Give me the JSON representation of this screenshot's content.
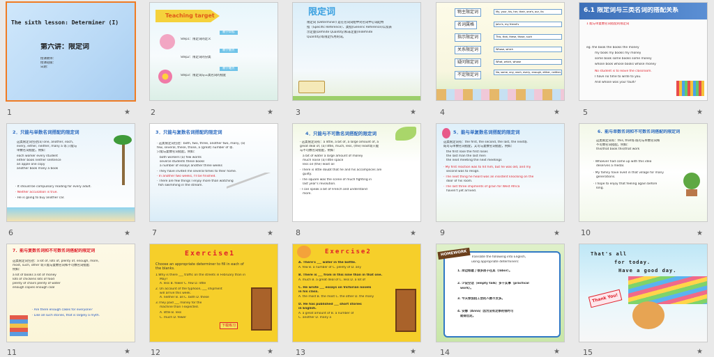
{
  "slides": [
    {
      "n": "1",
      "title": "The sixth lesson: Determiner (I)",
      "sub": "第六讲：限定词",
      "meta": [
        "授课教师：",
        "授课班级：",
        "日期："
      ]
    },
    {
      "n": "2",
      "title": "Teaching target",
      "steps": [
        "Step1：限定词的定义",
        "Step2：限定词的分类",
        "Step3：限定词与三类名词的搭配"
      ],
      "tags": [
        "教学目标",
        "教学重点",
        "教学难点"
      ]
    },
    {
      "n": "3",
      "title": "限定词",
      "lines": [
        "限定词 (Determiner) 是在名词词组中对名词中心词起特",
        "指（Specific Reference）、类指(Generic Reference)以及表",
        "示定量(Definite Quantity)和非定量(Indefinite",
        "Quantity)等限定作用的词。"
      ]
    },
    {
      "n": "4",
      "cats": [
        "物主限定词",
        "名词属格",
        "指示限定词",
        "关系限定词",
        "疑问限定词",
        "不定限定词"
      ],
      "vals": [
        "My, your, his, her, their, one's, our, its",
        "John's, my friend's",
        "This, that, these, those, such",
        "Whose, which",
        "What, which, whose",
        "No, some, any, each, every, enough, either, neither, all, both, half, several, many, much, more, most..."
      ]
    },
    {
      "n": "5",
      "title": "6.1 限定词与三类名词的搭配关系",
      "lines": [
        "1  能与单复数名词搭配的限定词",
        "eg. the book     the books     the money",
        "my book    my books    my money",
        "some book  some books  some money",
        "whose book  whose books  whose money",
        "No student is to leave the classroom.",
        "I have no time to write to you.",
        "And whose was your fault?"
      ]
    },
    {
      "n": "6",
      "title": "2．只能与单数名词搭配的限定词",
      "lines": [
        "这类限定词包括(a) one, another, each,",
        "every, either, neither, many a 等.只能与",
        "单数名词搭配，例如：",
        "each worker       every student",
        "either book       neither sentence",
        "an apple          one copy",
        "another book      many a book",
        "· It should be compulsory reading for every adult.",
        "· Neither accusation is true.",
        "· He is going to buy another car."
      ]
    },
    {
      "n": "7",
      "title": "3．只能与复数名词搭配的限定词",
      "lines": [
        "· 这类限定词包括：both, two, three, another two, many, (a)",
        "few, several, these, those, a (great) number of 等.",
        "只能与复数名词搭配，例如：",
        "both workers        (a) few words",
        "several students    these books",
        "a number of essays  another three weeks",
        "· They have invited me several times to their home.",
        "· In another two weeks, I'll be finished.",
        "· There are few things I enjoy more than watching",
        "fish swimming in the stream."
      ]
    },
    {
      "n": "8",
      "title": "4．只能与不可数名词搭配的限定词",
      "lines": [
        "· 这类限定词有：a little, a bit of, a large amount of, a",
        "great deal of, (a) little, much, less, (the) least等只能",
        "与不可数名词搭配，例如：",
        "a bit of water      a large amount of money",
        "much noise          (a) little space",
        "less oil            (the) least oil",
        "· There is little doubt that he and his accomplices are",
        "guilty.",
        "· The square was the scene of much fighting in",
        "last year's revolution.",
        "· I can speak a bit of French and understand",
        "more."
      ]
    },
    {
      "n": "9",
      "title": "5．能与单复数名词搭配的限定词",
      "lines": [
        "这类限定词有：the first, the second, the last, the next等.",
        "既可与单数名词搭配，又可与复数名词搭配，例如：",
        "the first rose       the first roses",
        "the last man         the last men",
        "the next meeting     the next meetings",
        "· My first reaction was to hit him, but he was old, and my",
        "second was to resign.",
        "· The next thing he heard was an insistent knocking on the",
        "door of his room.",
        "· The last three shipments of grain for West Africa",
        "haven't yet arrived."
      ]
    },
    {
      "n": "10",
      "title": "6．能与单数名词和不可数名词搭配的限定词",
      "lines": [
        "这类限定词有：this, that等.既可与单数名词和",
        "不可数名词搭配，例如：",
        "this/that book        this/that work",
        "· Whoever had come up with this idea",
        "deserves a medal.",
        "· My family have lived in that village for many",
        "generations.",
        "· I hope to enjoy that feeling again before",
        "long."
      ]
    },
    {
      "n": "11",
      "title": "7．能与复数名词和不可数名词搭配的限定词",
      "lines": [
        "这类限定词包括：a lot of, lots of, plenty of, enough, more,",
        "most, such, other 等只能与复数名词和不可数名词搭配.",
        "例如：",
        "a lot of books      a lot of money",
        "lots of chickens    lots of food",
        "plenty of chairs    plenty of water",
        "enough copies       enough coal",
        "· Are there enough cakes for everyone?",
        "· Like all such stories, that is largely a myth."
      ]
    },
    {
      "n": "12",
      "title": "Exercise1",
      "lines": [
        "Choose an appropriate determiner to fill in each of",
        "the blanks.",
        "1.Why is there ___ traffic on the streets in February than in",
        "May?",
        "A. less  B. fewer  C. few  D. little",
        "2. On account of the typhoon, ___ shipment",
        "will arrive this week.",
        "A. neither  B. all  C. both  D. these",
        "3.They paid ___ money for the",
        "machine than I expected.",
        "A. little     B. less",
        "C. much       D. fewer"
      ],
      "stamp": "下载练习"
    },
    {
      "n": "13",
      "title": "Exercise2",
      "lines": [
        "A. There's ___ water in the bottle.",
        "A. few   B. a number of   C. plenty of   D. any",
        "B. There is ___ from in this nine than in that one.",
        "A. much   B. a great deal of  C. less  D. a lot of",
        "C. He wrote ___ essays on Victorian novels",
        "in his class.",
        "A. the most  B. the most  C. the other  D. the many",
        "D. He has published ___ short stories",
        "in English.",
        "A. a great amount of   B. a number of",
        "C. another             D. many a"
      ]
    },
    {
      "n": "14",
      "badge": "HOMEWORK",
      "lines": [
        "Translate the following into English,",
        "using appropriate determiners:",
        "1. 岸边修建了很多房子在其（labor）。",
        "2. 少说空话（empty talk）多干实事（practical",
        "work）。",
        "3. 今天参加招工会的人数不太多。",
        "4. 安娜（Anna）因为没有足够的钱时可",
        "就得出走。"
      ]
    },
    {
      "n": "15",
      "lines": [
        "That's all",
        "for today.",
        "Have a good day."
      ],
      "sign": "Thank You!"
    }
  ],
  "star": "★"
}
